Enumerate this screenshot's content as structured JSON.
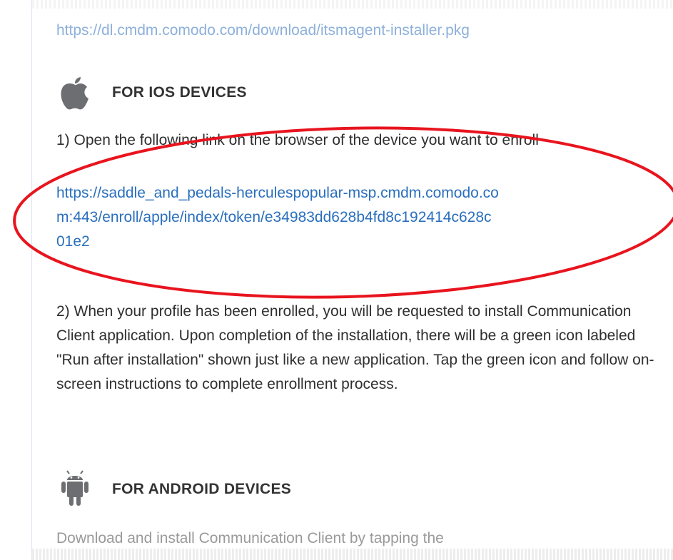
{
  "top_link": "https://dl.cmdm.comodo.com/download/itsmagent-installer.pkg",
  "ios": {
    "icon": "apple-icon",
    "title": "FOR IOS DEVICES",
    "step1_text": "1) Open the following link on the browser of the device you want to enroll",
    "enroll_link_line1": "https://saddle_and_pedals-herculespopular-msp.cmdm.comodo.co",
    "enroll_link_line2": "m:443/enroll/apple/index/token/e34983dd628b4fd8c192414c628c",
    "enroll_link_line3": "01e2",
    "step2_text": "2) When your profile has been enrolled, you will be requested to install Communication Client application. Upon completion of the installation, there will be a green icon labeled \"Run after installation\" shown just like a new application. Tap the green icon and follow on-screen instructions to complete enrollment process."
  },
  "android": {
    "icon": "android-icon",
    "title": "FOR ANDROID DEVICES",
    "intro_text": "Download and install Communication Client by tapping the"
  },
  "colors": {
    "link": "#2a6fbd",
    "annotation_ellipse": "#e8141e",
    "icon_gray": "#6d6e71"
  }
}
